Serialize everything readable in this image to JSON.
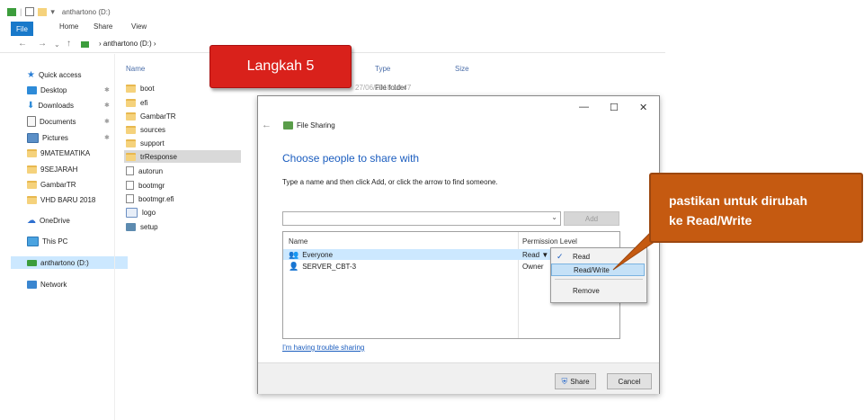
{
  "window": {
    "title": "anthartono (D:)"
  },
  "ribbon": {
    "tabs": [
      "File",
      "Home",
      "Share",
      "View"
    ]
  },
  "address": {
    "path": "anthartono (D:)"
  },
  "sidebar": {
    "items": [
      {
        "label": "Quick access",
        "icon": "star-icon"
      },
      {
        "label": "Desktop",
        "icon": "desktop-icon"
      },
      {
        "label": "Downloads",
        "icon": "download-icon"
      },
      {
        "label": "Documents",
        "icon": "documents-icon"
      },
      {
        "label": "Pictures",
        "icon": "pictures-icon"
      },
      {
        "label": "9MATEMATIKA",
        "icon": "folder-icon"
      },
      {
        "label": "9SEJARAH",
        "icon": "folder-icon"
      },
      {
        "label": "GambarTR",
        "icon": "folder-icon"
      },
      {
        "label": "VHD BARU 2018",
        "icon": "folder-icon"
      },
      {
        "label": "OneDrive",
        "icon": "cloud-icon"
      },
      {
        "label": "This PC",
        "icon": "computer-icon"
      },
      {
        "label": "anthartono (D:)",
        "icon": "drive-icon"
      },
      {
        "label": "Network",
        "icon": "network-icon"
      }
    ]
  },
  "file_list": {
    "columns": [
      "Name",
      "Type",
      "Size"
    ],
    "partial_date": "27/06/2018 10:47",
    "first_type": "File folder",
    "items": [
      "boot",
      "efi",
      "GambarTR",
      "sources",
      "support",
      "trResponse",
      "autorun",
      "bootmgr",
      "bootmgr.efi",
      "logo",
      "setup"
    ]
  },
  "callouts": {
    "step": "Langkah 5",
    "note_line1": "pastikan untuk dirubah",
    "note_line2": "ke Read/Write"
  },
  "dialog": {
    "title": "File Sharing",
    "heading": "Choose people to share with",
    "instruction": "Type a name and then click Add, or click the arrow to find someone.",
    "add_label": "Add",
    "table_headers": [
      "Name",
      "Permission Level"
    ],
    "rows": [
      {
        "name": "Everyone",
        "permission": "Read"
      },
      {
        "name": "SERVER_CBT-3",
        "permission": "Owner"
      }
    ],
    "trouble_link": "I'm having trouble sharing",
    "share_label": "Share",
    "cancel_label": "Cancel"
  },
  "permission_menu": {
    "items": [
      "Read",
      "Read/Write",
      "Remove"
    ]
  },
  "colors": {
    "accent": "#1979ca",
    "callout_red": "#d9211b",
    "callout_orange": "#c55a11",
    "link": "#1b5dbf"
  }
}
